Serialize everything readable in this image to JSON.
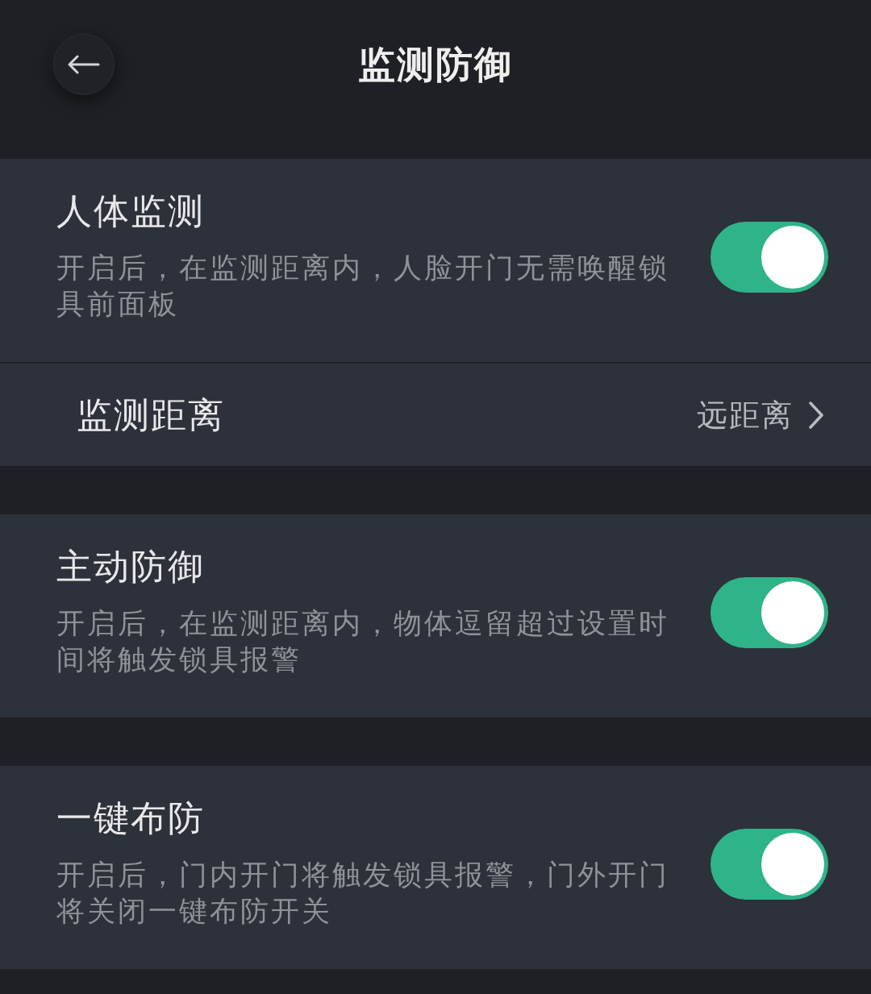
{
  "header": {
    "title": "监测防御"
  },
  "sections": [
    {
      "items": [
        {
          "kind": "toggle",
          "title": "人体监测",
          "description": "开启后，在监测距离内，人脸开门无需唤醒锁具前面板",
          "on": true
        },
        {
          "kind": "link",
          "label": "监测距离",
          "value": "远距离"
        }
      ]
    },
    {
      "items": [
        {
          "kind": "toggle",
          "title": "主动防御",
          "description": "开启后，在监测距离内，物体逗留超过设置时间将触发锁具报警",
          "on": true
        }
      ]
    },
    {
      "items": [
        {
          "kind": "toggle",
          "title": "一键布防",
          "description": "开启后，门内开门将触发锁具报警，门外开门将关闭一键布防开关",
          "on": true
        }
      ]
    }
  ]
}
